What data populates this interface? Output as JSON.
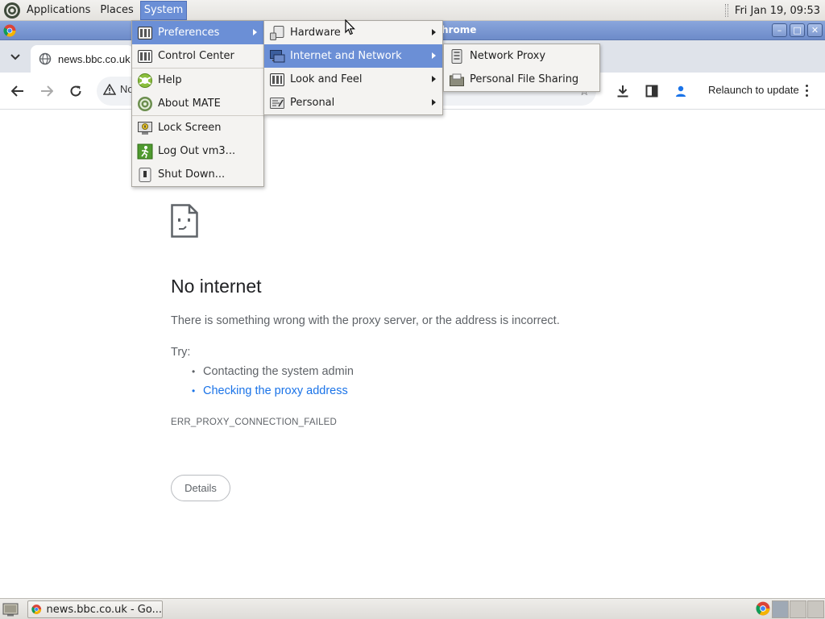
{
  "top_panel": {
    "menus": [
      "Applications",
      "Places",
      "System"
    ],
    "clock": "Fri Jan 19, 09:53"
  },
  "window": {
    "title": "hrome",
    "controls": [
      "minimize",
      "maximize",
      "close"
    ]
  },
  "tab": {
    "title": "news.bbc.co.uk"
  },
  "toolbar": {
    "omnibox_security": "No",
    "relaunch_label": "Relaunch to update"
  },
  "system_menu": {
    "items": [
      {
        "label": "Preferences",
        "icon": "preferences-icon",
        "submenu": true,
        "highlighted": true
      },
      {
        "label": "Control Center",
        "icon": "control-center-icon"
      },
      {
        "label": "Help",
        "icon": "help-icon"
      },
      {
        "label": "About MATE",
        "icon": "mate-icon"
      },
      {
        "label": "Lock Screen",
        "icon": "lock-screen-icon"
      },
      {
        "label": "Log Out vm3...",
        "icon": "log-out-icon"
      },
      {
        "label": "Shut Down...",
        "icon": "shut-down-icon"
      }
    ]
  },
  "preferences_menu": {
    "items": [
      {
        "label": "Hardware",
        "icon": "hardware-icon"
      },
      {
        "label": "Internet and Network",
        "icon": "network-icon",
        "highlighted": true
      },
      {
        "label": "Look and Feel",
        "icon": "look-and-feel-icon"
      },
      {
        "label": "Personal",
        "icon": "personal-icon"
      }
    ]
  },
  "network_menu": {
    "items": [
      {
        "label": "Network Proxy",
        "icon": "network-proxy-icon"
      },
      {
        "label": "Personal File Sharing",
        "icon": "file-sharing-icon"
      }
    ]
  },
  "error_page": {
    "title": "No internet",
    "description": "There is something wrong with the proxy server, or the address is incorrect.",
    "try_label": "Try:",
    "suggestions": [
      {
        "text": "Contacting the system admin",
        "link": false
      },
      {
        "text": "Checking the proxy address",
        "link": true
      }
    ],
    "error_code": "ERR_PROXY_CONNECTION_FAILED",
    "details_button": "Details"
  },
  "taskbar": {
    "window_label": "news.bbc.co.uk - Go..."
  },
  "colors": {
    "menu_highlight": "#6b8fd6",
    "title_bar": "#7a97d2",
    "link": "#1a73e8"
  }
}
